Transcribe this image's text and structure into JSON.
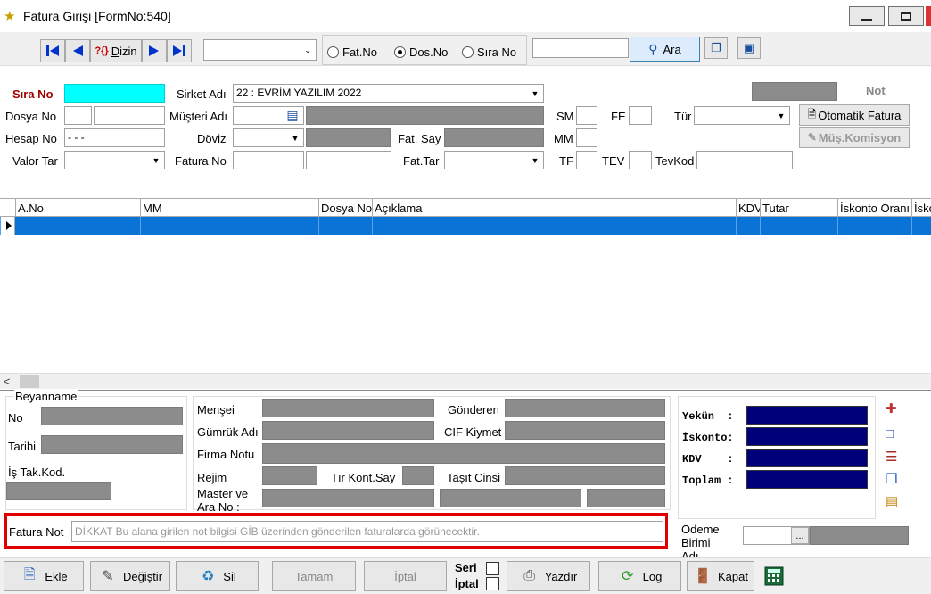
{
  "window": {
    "title": "Fatura Girişi [FormNo:540]"
  },
  "toolbar": {
    "dizin_label": "Dizin",
    "radio_fatno": "Fat.No",
    "radio_dosno": "Dos.No",
    "radio_sirano": "Sıra No",
    "search_button": "Ara"
  },
  "header": {
    "sira_no_label": "Sıra No",
    "sirket_adi_label": "Sirket Adı",
    "sirket_adi_value": "22 : EVRİM YAZILIM  2022",
    "not_label": "Not",
    "dosya_no_label": "Dosya No",
    "musteri_adi_label": "Müşteri Adı",
    "sm_label": "SM",
    "fe_label": "FE",
    "tur_label": "Tür",
    "otomatik_fatura_button": "Otomatik Fatura",
    "hesap_no_label": "Hesap No",
    "hesap_no_value": " - - -",
    "doviz_label": "Döviz",
    "fat_say_label": "Fat. Say",
    "mm_label": "MM",
    "mus_komisyon_button": "Müş.Komisyon",
    "valor_tar_label": "Valor Tar",
    "fatura_no_label": "Fatura No",
    "fat_tar_label": "Fat.Tar",
    "tf_label": "TF",
    "tev_label": "TEV",
    "tevkod_label": "TevKod"
  },
  "grid": {
    "columns": [
      "A.No",
      "MM",
      "Dosya No",
      "Açıklama",
      "KDV",
      "Tutar",
      "İskonto Oranı",
      "İsko"
    ]
  },
  "beyanname": {
    "group_label": "Beyanname",
    "no_label": "No",
    "tarihi_label": "Tarihi",
    "is_tak_kod_label": "İş Tak.Kod."
  },
  "details": {
    "mensei_label": "Menşei",
    "gonderen_label": "Gönderen",
    "gumruk_adi_label": "Gümrük Adı",
    "cif_kiymet_label": "CIF Kiymet",
    "firma_notu_label": "Firma Notu",
    "rejim_label": "Rejim",
    "tir_kont_say_label": "Tır Kont.Say",
    "tasit_cinsi_label": "Taşıt Cinsi",
    "master_label": "Master ve",
    "ara_no_label": "Ara No :"
  },
  "totals": {
    "yekun_label": "Yekün  :",
    "iskonto_label": "İskonto:",
    "kdv_label": "KDV    :",
    "toplam_label": "Toplam :"
  },
  "fatura_not": {
    "label": "Fatura Not",
    "placeholder": "DİKKAT Bu alana girilen not bilgisi GİB üzerinden gönderilen faturalarda görünecektir."
  },
  "odeme": {
    "label_1": "Ödeme",
    "label_2": "Birimi",
    "label_3": "Adı",
    "button": "..."
  },
  "bottom_bar": {
    "ekle": "Ekle",
    "degistir": "Değiştir",
    "sil": "Sil",
    "tamam": "Tamam",
    "iptal": "İptal",
    "seri_label": "Seri",
    "iptal_label": "İptal",
    "yazdir": "Yazdır",
    "log": "Log",
    "kapat": "Kapat"
  },
  "colors": {
    "title_bar": "#ffffff",
    "highlight_cyan": "#00ffff",
    "grid_selection": "#0a74d6",
    "sira_no_red": "#a00000",
    "alert_border": "#e00000",
    "totals_navy": "#00007a"
  }
}
